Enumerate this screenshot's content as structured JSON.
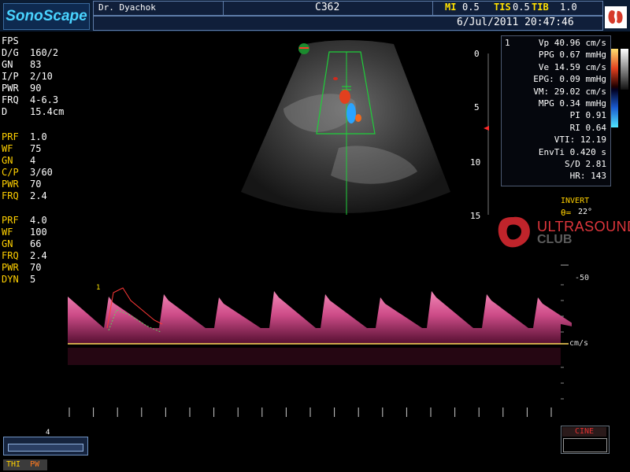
{
  "header": {
    "logo": "SonoScape",
    "doctor": "Dr. Dyachok",
    "probe": "C362",
    "mi_label": "MI",
    "mi_value": "0.5",
    "tis_label": "TIS",
    "tis_value": "0.5",
    "tib_label": "TIB",
    "tib_value": "1.0",
    "datetime": "6/Jul/2011 20:47:46"
  },
  "b_mode_params": [
    {
      "label": "FPS",
      "value": ""
    },
    {
      "label": "D/G",
      "value": "160/2"
    },
    {
      "label": "GN",
      "value": "83"
    },
    {
      "label": "I/P",
      "value": "2/10"
    },
    {
      "label": "PWR",
      "value": "90"
    },
    {
      "label": "FRQ",
      "value": "4-6.3"
    },
    {
      "label": "D",
      "value": "15.4cm"
    }
  ],
  "color_params": [
    {
      "label": "PRF",
      "value": "1.0"
    },
    {
      "label": "WF",
      "value": "75"
    },
    {
      "label": "GN",
      "value": "4"
    },
    {
      "label": "C/P",
      "value": "3/60"
    },
    {
      "label": "PWR",
      "value": "70"
    },
    {
      "label": "FRQ",
      "value": "2.4"
    }
  ],
  "pw_params": [
    {
      "label": "PRF",
      "value": "4.0"
    },
    {
      "label": "WF",
      "value": "100"
    },
    {
      "label": "GN",
      "value": "66"
    },
    {
      "label": "FRQ",
      "value": "2.4"
    },
    {
      "label": "PWR",
      "value": "70"
    },
    {
      "label": "DYN",
      "value": "5"
    }
  ],
  "measurements": {
    "index": "1",
    "lines": [
      "Vp 40.96 cm/s",
      "PPG 0.67 mmHg",
      "Ve 14.59 cm/s",
      "EPG: 0.09 mmHg",
      "VM: 29.02 cm/s",
      "MPG 0.34 mmHg",
      "PI 0.91",
      "RI 0.64",
      "VTI: 12.19",
      "EnvTi 0.420 s",
      "S/D 2.81",
      "HR: 143"
    ]
  },
  "depth_scale": [
    "0",
    "5",
    "10",
    "15"
  ],
  "doppler": {
    "invert_label": "INVERT",
    "angle_label": "θ=",
    "angle_value": "22°",
    "velocity_tick": "-50",
    "unit": "cm/s",
    "cycle_marker": "1"
  },
  "watermark": {
    "line1": "ULTRASOUND",
    "line2": "CLUB"
  },
  "zoom_value": "4",
  "cine_label": "CINE",
  "modes": {
    "thi": "THI",
    "pw": "PW"
  }
}
